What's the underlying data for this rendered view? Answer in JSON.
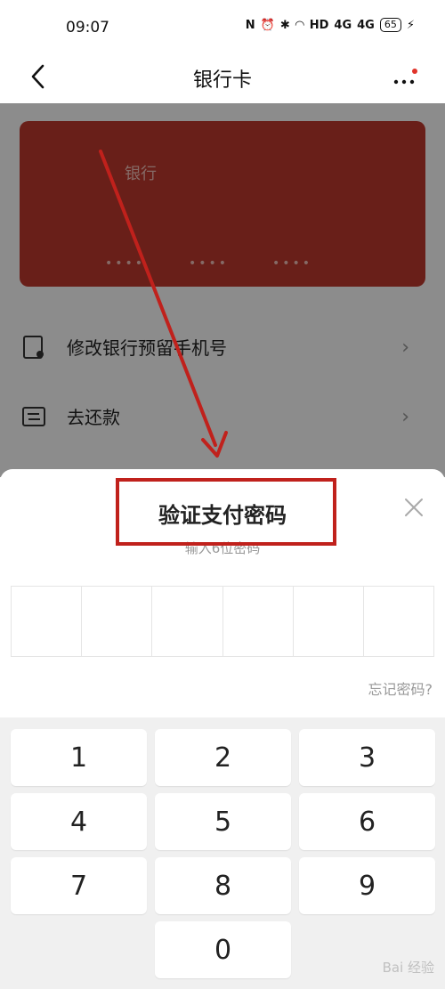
{
  "status_bar": {
    "time": "09:07",
    "icons": [
      "nfc-icon",
      "alarm-icon",
      "bluetooth-icon",
      "wifi-icon",
      "hd-icon",
      "signal-4g-icon",
      "signal-4g-icon",
      "battery-icon"
    ],
    "hd": "HD",
    "net1": "4G",
    "net2": "4G",
    "battery": "65"
  },
  "nav": {
    "title": "银行卡"
  },
  "card": {
    "bank_name": "银行",
    "masked_groups": [
      "••••",
      "••••",
      "••••"
    ],
    "color": "#c03a2e"
  },
  "menu": [
    {
      "label": "修改银行预留手机号",
      "icon": "phone-edit-icon"
    },
    {
      "label": "去还款",
      "icon": "repay-icon"
    }
  ],
  "sheet": {
    "title": "验证支付密码",
    "subtitle": "输入6位密码",
    "forgot": "忘记密码?"
  },
  "keypad": {
    "keys": [
      "1",
      "2",
      "3",
      "4",
      "5",
      "6",
      "7",
      "8",
      "9",
      "0"
    ]
  },
  "annotation_color": "#c0211c",
  "watermark": "Bai 经验"
}
